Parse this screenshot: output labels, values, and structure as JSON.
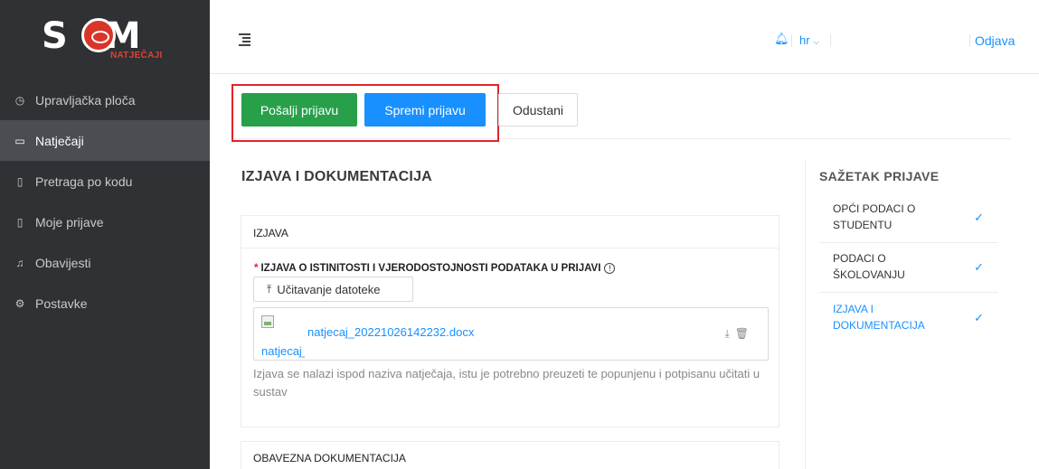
{
  "brand": {
    "logo_text": "S",
    "logo_text2": "M",
    "logo_sub": "NATJEČAJI"
  },
  "sidebar": {
    "items": [
      {
        "label": "Upravljačka ploča",
        "icon": "dashboard-icon"
      },
      {
        "label": "Natječaji",
        "icon": "folder-icon"
      },
      {
        "label": "Pretraga po kodu",
        "icon": "file-icon"
      },
      {
        "label": "Moje prijave",
        "icon": "file-text-icon"
      },
      {
        "label": "Obavijesti",
        "icon": "bell-icon"
      },
      {
        "label": "Postavke",
        "icon": "gear-icon"
      }
    ]
  },
  "topbar": {
    "language": "hr",
    "logout": "Odjava"
  },
  "actions": {
    "send": "Pošalji prijavu",
    "save": "Spremi prijavu",
    "cancel": "Odustani"
  },
  "main": {
    "section_title": "IZJAVA I DOKUMENTACIJA",
    "statement_card": {
      "title": "IZJAVA",
      "field_label": "IZJAVA O ISTINITOSTI I VJERODOSTOJNOSTI PODATAKA U PRIJAVI",
      "required_mark": "*",
      "upload_label": "Učitavanje datoteke",
      "file_name": "natjecaj_20221026142232.docx",
      "file_thumb_alt": "natjecaj_20221026142232.docx",
      "hint": "Izjava se nalazi ispod naziva natječaja, istu je potrebno preuzeti te popunjenu i potpisanu učitati u sustav"
    },
    "docs_card": {
      "title": "OBAVEZNA DOKUMENTACIJA"
    }
  },
  "summary": {
    "title": "SAŽETAK PRIJAVE",
    "items": [
      {
        "line1": "OPĆI PODACI O",
        "line2": "STUDENTU",
        "done": true,
        "active": false
      },
      {
        "line1": "PODACI O",
        "line2": "ŠKOLOVANJU",
        "done": true,
        "active": false
      },
      {
        "line1": "IZJAVA I",
        "line2": "DOKUMENTACIJA",
        "done": true,
        "active": true
      }
    ]
  },
  "colors": {
    "primary": "#1890ff",
    "success": "#28a04a",
    "danger": "#e0232a",
    "sidebar": "#2f3134"
  }
}
